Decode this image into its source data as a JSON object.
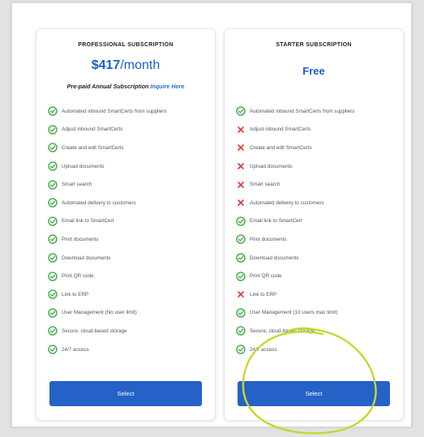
{
  "plans": [
    {
      "name": "PROFESSIONAL SUBSCRIPTION",
      "price_amount": "$417",
      "price_period": "/month",
      "note_text": "Pre-paid Annual Subscription",
      "note_link": "Inquire Here",
      "select_label": "Select",
      "features": [
        {
          "label": "Automated inbound SmartCerts from suppliers",
          "included": true
        },
        {
          "label": "Adjust inbound SmartCerts",
          "included": true
        },
        {
          "label": "Create and edit SmartCerts",
          "included": true
        },
        {
          "label": "Upload documents",
          "included": true
        },
        {
          "label": "Smart search",
          "included": true
        },
        {
          "label": "Automated delivery to customers",
          "included": true
        },
        {
          "label": "Email link to SmartCert",
          "included": true
        },
        {
          "label": "Print documents",
          "included": true
        },
        {
          "label": "Download documents",
          "included": true
        },
        {
          "label": "Print QR code",
          "included": true
        },
        {
          "label": "Link to ERP",
          "included": true
        },
        {
          "label": "User Management (No user limit)",
          "included": true
        },
        {
          "label": "Secure, cloud-based storage",
          "included": true
        },
        {
          "label": "24/7 access",
          "included": true
        }
      ]
    },
    {
      "name": "STARTER SUBSCRIPTION",
      "price_free": "Free",
      "select_label": "Select",
      "features": [
        {
          "label": "Automated inbound SmartCerts from suppliers",
          "included": true
        },
        {
          "label": "Adjust inbound SmartCerts",
          "included": false
        },
        {
          "label": "Create and edit SmartCerts",
          "included": false
        },
        {
          "label": "Upload documents",
          "included": false
        },
        {
          "label": "Smart search",
          "included": false
        },
        {
          "label": "Automated delivery to customers",
          "included": false
        },
        {
          "label": "Email link to SmartCert",
          "included": true
        },
        {
          "label": "Print documents",
          "included": true
        },
        {
          "label": "Download documents",
          "included": true
        },
        {
          "label": "Print QR code",
          "included": true
        },
        {
          "label": "Link to ERP",
          "included": false
        },
        {
          "label": "User Management (10 users max limit)",
          "included": true
        },
        {
          "label": "Secure, cloud-based storage",
          "included": true
        },
        {
          "label": "24/7 access",
          "included": true
        }
      ]
    }
  ],
  "icons": {
    "included": "check-circle-icon",
    "excluded": "x-icon"
  },
  "colors": {
    "check": "#4caf50",
    "cross": "#e53935",
    "accent": "#2462c8",
    "price": "#1f5fc7",
    "link": "#2a6fd6",
    "highlight": "#c4d92e"
  }
}
